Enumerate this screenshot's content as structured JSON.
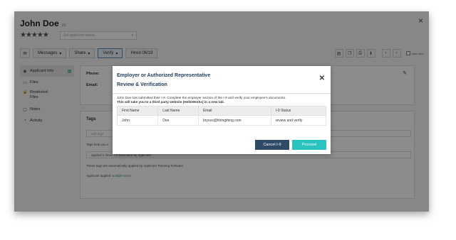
{
  "header": {
    "candidate_name": "John Doe",
    "candidate_badge": "(6)",
    "close_glyph": "×",
    "stars": "★★★★★",
    "status_placeholder": "Set applicant status...",
    "status_caret": "▾"
  },
  "toolbar": {
    "mail_glyph": "✉",
    "messages_label": "Messages",
    "share_label": "Share",
    "verify_label": "Verify",
    "caret": "▾",
    "hired_label": "Hired 06/19",
    "right_icons": [
      {
        "name": "contact-card-icon",
        "glyph": "▤"
      },
      {
        "name": "copy-icon",
        "glyph": "❐"
      },
      {
        "name": "print-icon",
        "glyph": "⎙"
      },
      {
        "name": "download-icon",
        "glyph": "⬇"
      },
      {
        "name": "prev-icon",
        "glyph": "‹"
      },
      {
        "name": "next-icon",
        "glyph": "›"
      }
    ],
    "auto_next_label": "auto next"
  },
  "sidebar": {
    "items": [
      {
        "label": "Applicant Info",
        "icon": "◉",
        "active": true
      },
      {
        "label": "Files",
        "icon": "▭"
      },
      {
        "label": "Restricted",
        "label2": "Files",
        "icon": "🔒"
      },
      {
        "label": "Notes",
        "icon": "▢"
      },
      {
        "label": "Activity",
        "icon": "◔"
      }
    ]
  },
  "profile": {
    "phone_label": "Phone:",
    "email_label": "Email:",
    "pencil_glyph": "✎"
  },
  "tags": {
    "title": "Tags",
    "input_placeholder": "add tags",
    "help_text": "Tags help you e",
    "applied_row": "applied 2 times   I-9 Submitted by Applicant",
    "auto_text": "These tags are automatically applied by Applicant Tracking Software",
    "applied_prefix": "Applicant applied ",
    "applied_link": "multiple times."
  },
  "modal": {
    "title_line1": "Employer or Authorized Representative",
    "title_line2": "Review & Verification",
    "close_glyph": "✕",
    "body_text": "John Doe has submitted their I-9. Complete the employer section of the I-9 and verify your employee's documents.",
    "body_bold": "This will take you to a third party website (HelloWorks) in a new tab.",
    "table": {
      "headers": [
        "First Name",
        "Last Name",
        "Email",
        "I-9 Status"
      ],
      "row": [
        "John",
        "Doe",
        "bryces@hiringthing.com",
        "review and verify"
      ]
    },
    "cancel_label": "Cancel I-9",
    "proceed_label": "Proceed"
  }
}
